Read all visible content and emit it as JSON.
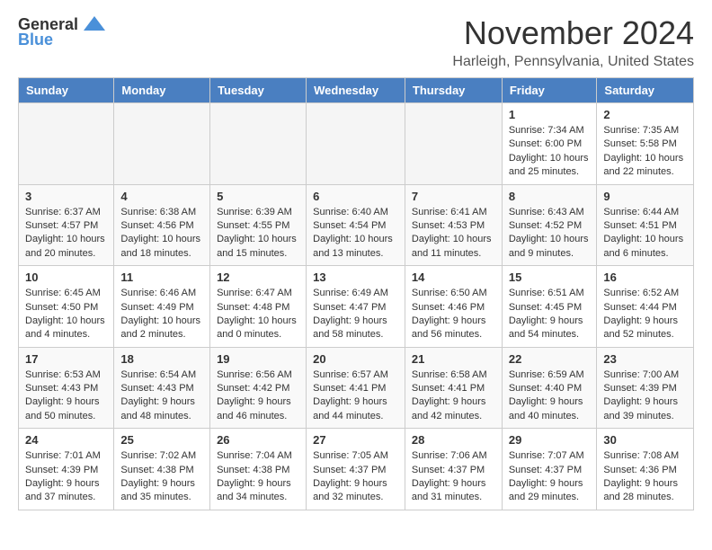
{
  "logo": {
    "general": "General",
    "blue": "Blue"
  },
  "title": "November 2024",
  "location": "Harleigh, Pennsylvania, United States",
  "weekdays": [
    "Sunday",
    "Monday",
    "Tuesday",
    "Wednesday",
    "Thursday",
    "Friday",
    "Saturday"
  ],
  "weeks": [
    [
      {
        "day": "",
        "info": ""
      },
      {
        "day": "",
        "info": ""
      },
      {
        "day": "",
        "info": ""
      },
      {
        "day": "",
        "info": ""
      },
      {
        "day": "",
        "info": ""
      },
      {
        "day": "1",
        "info": "Sunrise: 7:34 AM\nSunset: 6:00 PM\nDaylight: 10 hours and 25 minutes."
      },
      {
        "day": "2",
        "info": "Sunrise: 7:35 AM\nSunset: 5:58 PM\nDaylight: 10 hours and 22 minutes."
      }
    ],
    [
      {
        "day": "3",
        "info": "Sunrise: 6:37 AM\nSunset: 4:57 PM\nDaylight: 10 hours and 20 minutes."
      },
      {
        "day": "4",
        "info": "Sunrise: 6:38 AM\nSunset: 4:56 PM\nDaylight: 10 hours and 18 minutes."
      },
      {
        "day": "5",
        "info": "Sunrise: 6:39 AM\nSunset: 4:55 PM\nDaylight: 10 hours and 15 minutes."
      },
      {
        "day": "6",
        "info": "Sunrise: 6:40 AM\nSunset: 4:54 PM\nDaylight: 10 hours and 13 minutes."
      },
      {
        "day": "7",
        "info": "Sunrise: 6:41 AM\nSunset: 4:53 PM\nDaylight: 10 hours and 11 minutes."
      },
      {
        "day": "8",
        "info": "Sunrise: 6:43 AM\nSunset: 4:52 PM\nDaylight: 10 hours and 9 minutes."
      },
      {
        "day": "9",
        "info": "Sunrise: 6:44 AM\nSunset: 4:51 PM\nDaylight: 10 hours and 6 minutes."
      }
    ],
    [
      {
        "day": "10",
        "info": "Sunrise: 6:45 AM\nSunset: 4:50 PM\nDaylight: 10 hours and 4 minutes."
      },
      {
        "day": "11",
        "info": "Sunrise: 6:46 AM\nSunset: 4:49 PM\nDaylight: 10 hours and 2 minutes."
      },
      {
        "day": "12",
        "info": "Sunrise: 6:47 AM\nSunset: 4:48 PM\nDaylight: 10 hours and 0 minutes."
      },
      {
        "day": "13",
        "info": "Sunrise: 6:49 AM\nSunset: 4:47 PM\nDaylight: 9 hours and 58 minutes."
      },
      {
        "day": "14",
        "info": "Sunrise: 6:50 AM\nSunset: 4:46 PM\nDaylight: 9 hours and 56 minutes."
      },
      {
        "day": "15",
        "info": "Sunrise: 6:51 AM\nSunset: 4:45 PM\nDaylight: 9 hours and 54 minutes."
      },
      {
        "day": "16",
        "info": "Sunrise: 6:52 AM\nSunset: 4:44 PM\nDaylight: 9 hours and 52 minutes."
      }
    ],
    [
      {
        "day": "17",
        "info": "Sunrise: 6:53 AM\nSunset: 4:43 PM\nDaylight: 9 hours and 50 minutes."
      },
      {
        "day": "18",
        "info": "Sunrise: 6:54 AM\nSunset: 4:43 PM\nDaylight: 9 hours and 48 minutes."
      },
      {
        "day": "19",
        "info": "Sunrise: 6:56 AM\nSunset: 4:42 PM\nDaylight: 9 hours and 46 minutes."
      },
      {
        "day": "20",
        "info": "Sunrise: 6:57 AM\nSunset: 4:41 PM\nDaylight: 9 hours and 44 minutes."
      },
      {
        "day": "21",
        "info": "Sunrise: 6:58 AM\nSunset: 4:41 PM\nDaylight: 9 hours and 42 minutes."
      },
      {
        "day": "22",
        "info": "Sunrise: 6:59 AM\nSunset: 4:40 PM\nDaylight: 9 hours and 40 minutes."
      },
      {
        "day": "23",
        "info": "Sunrise: 7:00 AM\nSunset: 4:39 PM\nDaylight: 9 hours and 39 minutes."
      }
    ],
    [
      {
        "day": "24",
        "info": "Sunrise: 7:01 AM\nSunset: 4:39 PM\nDaylight: 9 hours and 37 minutes."
      },
      {
        "day": "25",
        "info": "Sunrise: 7:02 AM\nSunset: 4:38 PM\nDaylight: 9 hours and 35 minutes."
      },
      {
        "day": "26",
        "info": "Sunrise: 7:04 AM\nSunset: 4:38 PM\nDaylight: 9 hours and 34 minutes."
      },
      {
        "day": "27",
        "info": "Sunrise: 7:05 AM\nSunset: 4:37 PM\nDaylight: 9 hours and 32 minutes."
      },
      {
        "day": "28",
        "info": "Sunrise: 7:06 AM\nSunset: 4:37 PM\nDaylight: 9 hours and 31 minutes."
      },
      {
        "day": "29",
        "info": "Sunrise: 7:07 AM\nSunset: 4:37 PM\nDaylight: 9 hours and 29 minutes."
      },
      {
        "day": "30",
        "info": "Sunrise: 7:08 AM\nSunset: 4:36 PM\nDaylight: 9 hours and 28 minutes."
      }
    ]
  ]
}
